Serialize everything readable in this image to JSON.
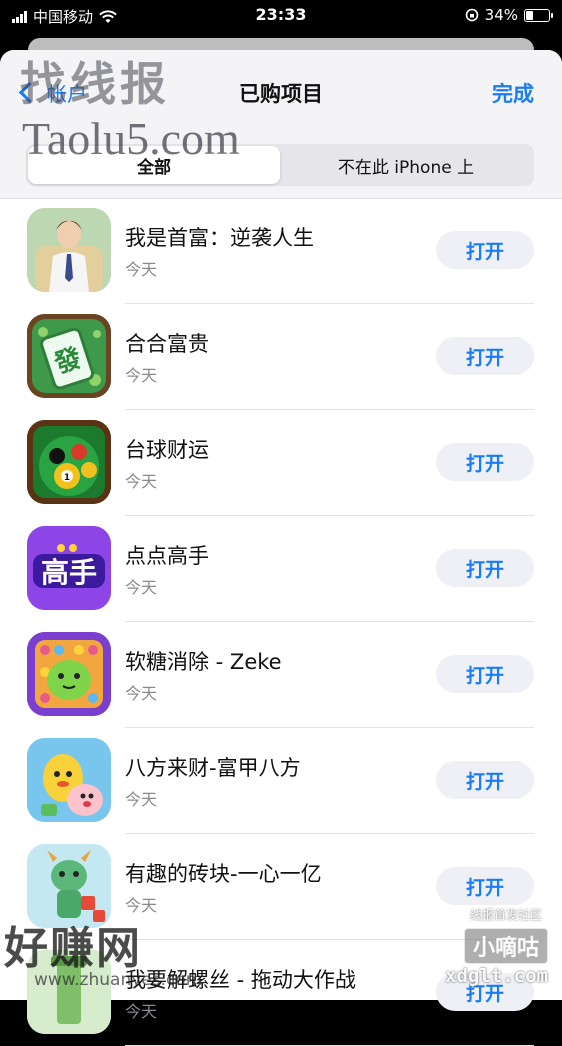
{
  "status_bar": {
    "carrier": "中国移动",
    "time": "23:33",
    "battery_percent": "34%",
    "battery_level": 0.34
  },
  "nav": {
    "back_label": "帐户",
    "title": "已购项目",
    "done_label": "完成"
  },
  "segments": {
    "all": "全部",
    "not_on_device": "不在此 iPhone 上",
    "selected": "all"
  },
  "apps": [
    {
      "name": "我是首富：逆袭人生",
      "subtitle": "今天",
      "action": "打开",
      "icon": "businessman-app-icon"
    },
    {
      "name": "合合富贵",
      "subtitle": "今天",
      "action": "打开",
      "icon": "mahjong-tile-app-icon"
    },
    {
      "name": "台球财运",
      "subtitle": "今天",
      "action": "打开",
      "icon": "billiards-app-icon"
    },
    {
      "name": "点点高手",
      "subtitle": "今天",
      "action": "打开",
      "icon": "gaoshou-app-icon"
    },
    {
      "name": "软糖消除 - Zeke",
      "subtitle": "今天",
      "action": "打开",
      "icon": "jelly-candy-app-icon"
    },
    {
      "name": "八方来财-富甲八方",
      "subtitle": "今天",
      "action": "打开",
      "icon": "cartoon-characters-app-icon"
    },
    {
      "name": "有趣的砖块-一心一亿",
      "subtitle": "今天",
      "action": "打开",
      "icon": "dragon-app-icon"
    },
    {
      "name": "我要解螺丝 - 拖动大作战",
      "subtitle": "今天",
      "action": "打开",
      "icon": "screw-app-icon"
    }
  ],
  "watermarks": {
    "zhaoxianbao": "找线报",
    "taolu": "Taolu5.com",
    "haozhuanwang": "好赚网",
    "zhuanyes": "www.zhuanyes.com",
    "xbshequ": "线报首发社区",
    "xiaodigu": "小嘀咕",
    "xdglt": "xdglt.com"
  }
}
